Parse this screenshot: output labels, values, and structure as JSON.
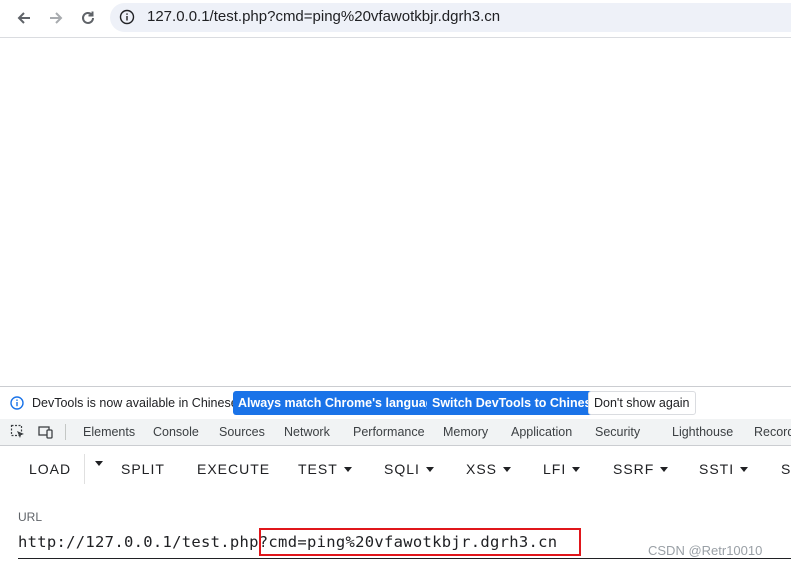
{
  "browser": {
    "url": "127.0.0.1/test.php?cmd=ping%20vfawotkbjr.dgrh3.cn"
  },
  "infobar": {
    "message": "DevTools is now available in Chinese!",
    "btn_match": "Always match Chrome's language",
    "btn_switch": "Switch DevTools to Chinese",
    "btn_dismiss": "Don't show again"
  },
  "devtools_tabs": [
    "Elements",
    "Console",
    "Sources",
    "Network",
    "Performance",
    "Memory",
    "Application",
    "Security",
    "Lighthouse",
    "Recorder"
  ],
  "hackbar": {
    "load": "LOAD",
    "split": "SPLIT",
    "execute": "EXECUTE",
    "test": "TEST",
    "sqli": "SQLI",
    "xss": "XSS",
    "lfi": "LFI",
    "ssrf": "SSRF",
    "ssti": "SSTI",
    "more": "S"
  },
  "url_panel": {
    "label": "URL",
    "value_prefix": "http://127.0.0.1/test.php",
    "value_query": "?cmd=ping%20vfawotkbjr.dgrh3.cn"
  },
  "watermark": "CSDN @Retr10010",
  "colors": {
    "accent_blue": "#1a73e8",
    "highlight_red": "#e0161b"
  }
}
